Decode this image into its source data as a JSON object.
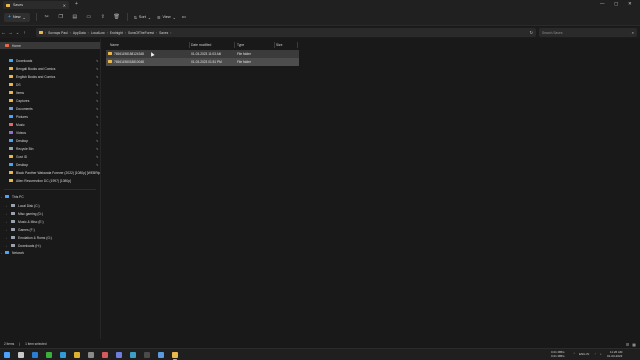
{
  "window": {
    "tab_title": "Saves",
    "tab_close": "✕",
    "tab_add": "+",
    "controls": {
      "minimize": "—",
      "maximize": "▢",
      "close": "✕"
    }
  },
  "commandbar": {
    "new_label": "New",
    "sort_label": "Sort",
    "view_label": "View",
    "more": "•••",
    "icons": [
      "cut-icon",
      "copy-icon",
      "paste-icon",
      "rename-icon",
      "share-icon",
      "delete-icon"
    ]
  },
  "address": {
    "nav": {
      "back": "←",
      "forward": "→",
      "up": "↑",
      "recent": "⌄"
    },
    "crumbs": [
      "Sovraps Paul",
      "AppData",
      "LocalLow",
      "Endnight",
      "SonsOfTheForest",
      "Saves"
    ],
    "refresh": "↻",
    "search_placeholder": "Search Saves"
  },
  "sidebar": {
    "home": "Home",
    "quick_access": [
      {
        "label": "Downloads",
        "color": "#3fa9f5"
      },
      {
        "label": "Bengali Books and Comics",
        "color": "#e8b94a"
      },
      {
        "label": "English Books and Comics",
        "color": "#e8b94a"
      },
      {
        "label": "DS",
        "color": "#e8b94a"
      },
      {
        "label": "Items",
        "color": "#e8b94a"
      },
      {
        "label": "Captures",
        "color": "#e8b94a"
      },
      {
        "label": "Documents",
        "color": "#6f9fd8"
      },
      {
        "label": "Pictures",
        "color": "#4aa3ff"
      },
      {
        "label": "Music",
        "color": "#e06b6b"
      },
      {
        "label": "Videos",
        "color": "#9b6bd8"
      },
      {
        "label": "Desktop",
        "color": "#4aa3ff"
      },
      {
        "label": "Recycle Bin",
        "color": "#9aa3ad"
      },
      {
        "label": "Govt ID",
        "color": "#e8b94a"
      },
      {
        "label": "Desktop",
        "color": "#4aa3ff"
      },
      {
        "label": "Black Panther Wakanda Forever (2022) [1080p] [WEBRip...",
        "color": "#e8b94a"
      },
      {
        "label": "Alien Resurrection DC (1997) [1080p]",
        "color": "#e8b94a"
      }
    ],
    "this_pc": "This PC",
    "drives": [
      "Local Disk (C:)",
      "Misc gaming (D:)",
      "Music & Misc (E:)",
      "Games (F:)",
      "Emulation & Roms (G:)",
      "Downloads (H:)"
    ],
    "network": "Network"
  },
  "main": {
    "columns": [
      "Name",
      "Date modified",
      "Type",
      "Size"
    ],
    "rows": [
      {
        "name": "76561198158124348",
        "date": "01-03-2023 11:03 AM",
        "type": "File folder",
        "size": ""
      },
      {
        "name": "76561198018810048",
        "date": "01-03-2023 01:51 PM",
        "type": "File folder",
        "size": ""
      }
    ]
  },
  "status": {
    "items": "2 items",
    "selected": "1 item selected"
  },
  "taskbar": {
    "apps": [
      {
        "name": "start-icon",
        "color": "#4aa3ff"
      },
      {
        "name": "search-icon",
        "color": "#c9c9c9"
      },
      {
        "name": "steam-icon",
        "color": "#2a7fd4"
      },
      {
        "name": "xbox-icon",
        "color": "#3cae3c"
      },
      {
        "name": "edge-icon",
        "color": "#2f9bd8"
      },
      {
        "name": "chrome-icon",
        "color": "#e0b030"
      },
      {
        "name": "app-icon",
        "color": "#8a8a8a"
      },
      {
        "name": "app-icon-2",
        "color": "#d65a5a"
      },
      {
        "name": "app-icon-3",
        "color": "#6c7ee0"
      },
      {
        "name": "app-icon-4",
        "color": "#3aa0c8"
      },
      {
        "name": "terminal-icon",
        "color": "#4a4a4a"
      },
      {
        "name": "app-icon-5",
        "color": "#5a9be0"
      },
      {
        "name": "files-icon",
        "color": "#e8b94a"
      }
    ],
    "network_up": "0.01 MB/s",
    "network_down": "0.01 MB/s",
    "tray_lang": "ENG IN",
    "time": "11:26 AM",
    "date": "01-03-2023"
  }
}
